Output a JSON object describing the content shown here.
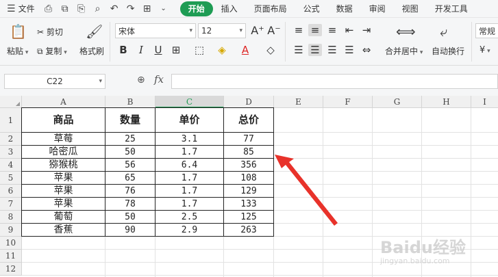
{
  "menu": {
    "file_label": "文件",
    "tabs": [
      "开始",
      "插入",
      "页面布局",
      "公式",
      "数据",
      "审阅",
      "视图",
      "开发工具"
    ],
    "active_tab": "开始"
  },
  "ribbon": {
    "paste": "粘贴",
    "cut": "剪切",
    "copy": "复制",
    "format_painter": "格式刷",
    "font_name": "宋体",
    "font_size": "12",
    "merge_center": "合并居中",
    "wrap_text": "自动换行",
    "number_format": "常规",
    "currency_symbol": "¥"
  },
  "formula_bar": {
    "name_box": "C22",
    "fx": "fx",
    "value": ""
  },
  "grid": {
    "columns": [
      "A",
      "B",
      "C",
      "D",
      "E",
      "F",
      "G",
      "H",
      "I"
    ],
    "selected_column": "C",
    "rows": [
      "1",
      "2",
      "3",
      "4",
      "5",
      "6",
      "7",
      "8",
      "9",
      "10",
      "11",
      "12"
    ],
    "table_headers": [
      "商品",
      "数量",
      "单价",
      "总价"
    ],
    "table_rows": [
      [
        "草莓",
        "25",
        "3.1",
        "77"
      ],
      [
        "哈密瓜",
        "50",
        "1.7",
        "85"
      ],
      [
        "猕猴桃",
        "56",
        "6.4",
        "356"
      ],
      [
        "苹果",
        "65",
        "1.7",
        "108"
      ],
      [
        "苹果",
        "76",
        "1.7",
        "129"
      ],
      [
        "苹果",
        "78",
        "1.7",
        "133"
      ],
      [
        "葡萄",
        "50",
        "2.5",
        "125"
      ],
      [
        "香蕉",
        "90",
        "2.9",
        "263"
      ]
    ]
  },
  "colors": {
    "accent": "#1e9c54",
    "arrow": "#e8322a"
  },
  "watermark": {
    "brand": "Baidu经验",
    "url": "jingyan.baidu.com"
  }
}
